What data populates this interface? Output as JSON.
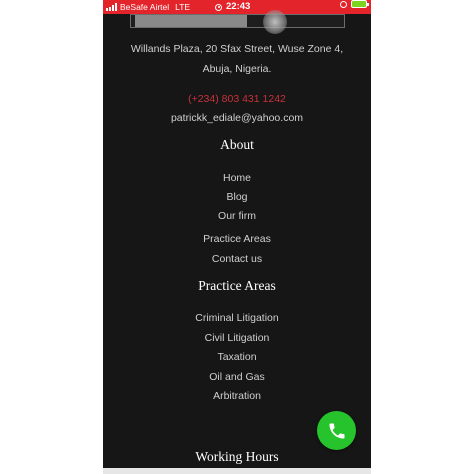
{
  "status_bar": {
    "carrier": "BeSafe Airtel",
    "network": "LTE",
    "time": "22:43",
    "color": "#e3242b"
  },
  "contact": {
    "address_line1": "Willands Plaza, 20 Sfax Street, Wuse Zone 4,",
    "address_line2": "Abuja, Nigeria.",
    "phone": "(+234) 803 431 1242",
    "email": "patrickk_ediale@yahoo.com"
  },
  "about": {
    "heading": "About",
    "links": [
      "Home",
      "Blog",
      "Our firm",
      "Practice Areas",
      "Contact us"
    ]
  },
  "practice_areas": {
    "heading": "Practice Areas",
    "links": [
      "Criminal Litigation",
      "Civil Litigation",
      "Taxation",
      "Oil and Gas",
      "Arbitration"
    ]
  },
  "working_hours": {
    "heading": "Working Hours"
  },
  "fab": {
    "icon": "phone-icon",
    "color": "#27c32c"
  }
}
